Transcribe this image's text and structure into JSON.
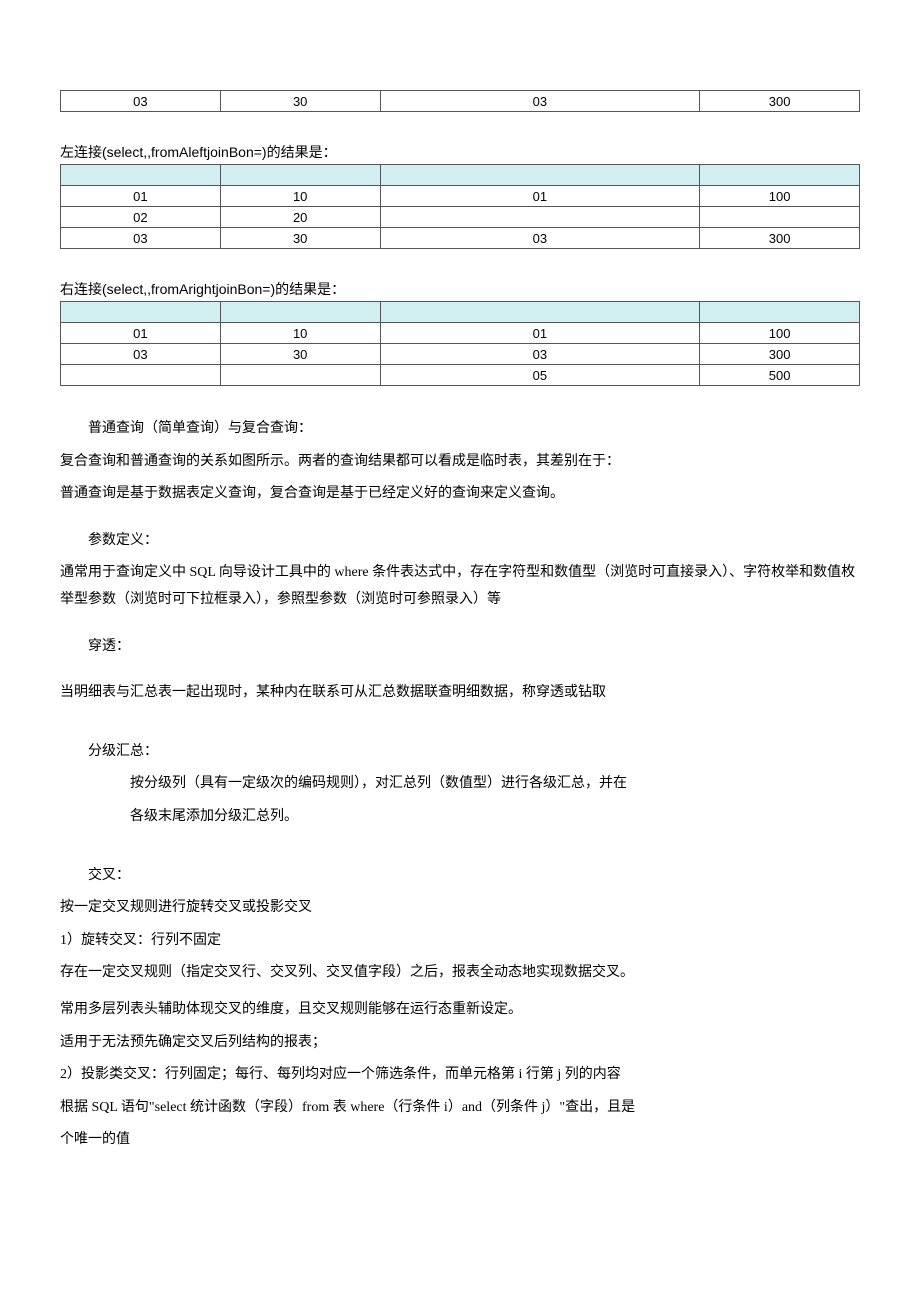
{
  "table_top": {
    "row": [
      "03",
      "30",
      "03",
      "300"
    ]
  },
  "left_join": {
    "caption": "左连接(select,,fromAleftjoinBon=)的结果是：",
    "rows": [
      [
        "",
        "",
        "",
        ""
      ],
      [
        "01",
        "10",
        "01",
        "100"
      ],
      [
        "02",
        "20",
        "",
        ""
      ],
      [
        "03",
        "30",
        "03",
        "300"
      ]
    ]
  },
  "right_join": {
    "caption": "右连接(select,,fromArightjoinBon=)的结果是：",
    "rows": [
      [
        "",
        "",
        "",
        ""
      ],
      [
        "01",
        "10",
        "01",
        "100"
      ],
      [
        "03",
        "30",
        "03",
        "300"
      ],
      [
        "",
        "",
        "05",
        "500"
      ]
    ]
  },
  "p1": "普通查询（简单查询）与复合查询：",
  "p2": "复合查询和普通查询的关系如图所示。两者的查询结果都可以看成是临时表，其差别在于：",
  "p3": "普通查询是基于数据表定义查询，复合查询是基于已经定义好的查询来定义查询。",
  "p4": "参数定义：",
  "p5": "通常用于查询定义中 SQL 向导设计工具中的 where 条件表达式中，存在字符型和数值型（浏览时可直接录入）、字符枚举和数值枚举型参数（浏览时可下拉框录入），参照型参数（浏览时可参照录入）等",
  "p6": "穿透：",
  "p7": "当明细表与汇总表一起出现时，某种内在联系可从汇总数据联查明细数据，称穿透或钻取",
  "p8": "分级汇总：",
  "p9": "按分级列（具有一定级次的编码规则），对汇总列（数值型）进行各级汇总，并在",
  "p10": "各级末尾添加分级汇总列。",
  "p11": "交叉：",
  "p12": "按一定交叉规则进行旋转交叉或投影交叉",
  "p13": "1）旋转交叉：行列不固定",
  "p14": "存在一定交叉规则（指定交叉行、交叉列、交叉值字段）之后，报表全动态地实现数据交叉。",
  "p15": "常用多层列表头辅助体现交叉的维度，且交叉规则能够在运行态重新设定。",
  "p16": "适用于无法预先确定交叉后列结构的报表；",
  "p17": "2）投影类交叉：行列固定；每行、每列均对应一个筛选条件，而单元格第 i 行第 j 列的内容",
  "p18": "根据 SQL 语句\"select 统计函数（字段）from 表 where（行条件 i）and（列条件 j）\"查出，且是",
  "p19": "个唯一的值"
}
